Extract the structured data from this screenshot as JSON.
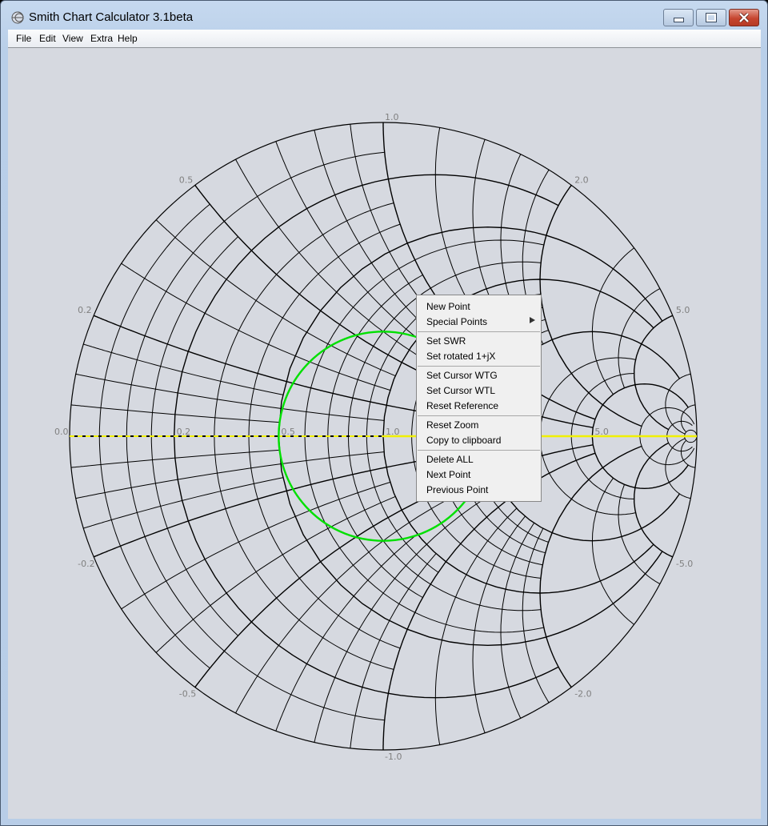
{
  "window": {
    "title": "Smith Chart Calculator 3.1beta",
    "controls": {
      "minimize": "minimize-icon",
      "maximize": "maximize-icon",
      "close": "close-icon"
    }
  },
  "menubar": [
    "File",
    "Edit",
    "View",
    "Extra",
    "Help"
  ],
  "chart": {
    "type": "smith-chart",
    "real_axis_labels": [
      "0.0",
      "0.2",
      "0.5",
      "1.0",
      "5.0"
    ],
    "reactance_labels_upper": [
      "0.2",
      "0.5",
      "1.0",
      "2.0",
      "5.0"
    ],
    "reactance_labels_lower": [
      "-0.2",
      "-0.5",
      "-1.0",
      "-2.0",
      "-5.0"
    ],
    "swr_circle": {
      "swr": 2.0,
      "color": "#00e000"
    },
    "real_axis_color": "#f0f000",
    "grid_color": "#000000",
    "background": "#d6d9e0"
  },
  "context_menu": {
    "groups": [
      [
        {
          "label": "New Point"
        },
        {
          "label": "Special Points",
          "submenu": true
        }
      ],
      [
        {
          "label": "Set SWR"
        },
        {
          "label": "Set rotated 1+jX"
        }
      ],
      [
        {
          "label": "Set Cursor WTG"
        },
        {
          "label": "Set Cursor WTL"
        },
        {
          "label": "Reset Reference"
        }
      ],
      [
        {
          "label": "Reset Zoom"
        },
        {
          "label": "Copy to clipboard"
        }
      ],
      [
        {
          "label": "Delete ALL"
        },
        {
          "label": "Next Point"
        },
        {
          "label": "Previous Point"
        }
      ]
    ]
  }
}
